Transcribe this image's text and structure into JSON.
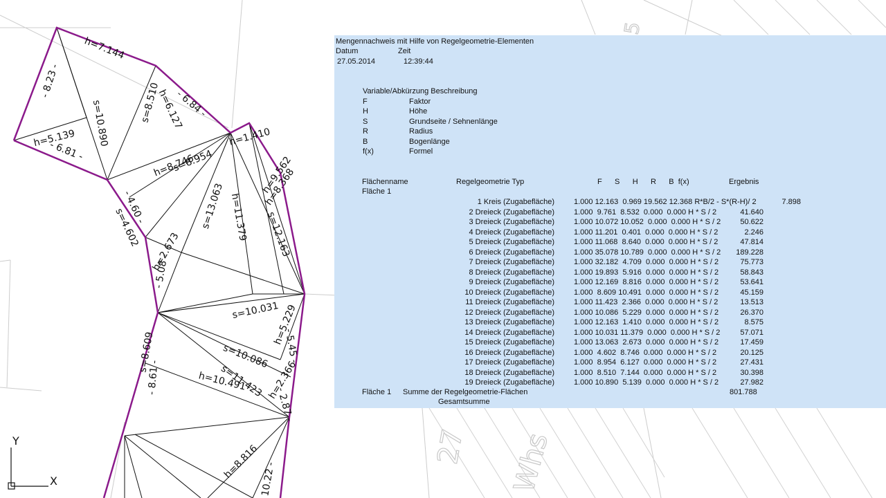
{
  "drawing": {
    "dimension_labels": [
      "h=7.144",
      "s=10.890",
      "s=8.510",
      "h=6.127",
      "- 6.84 -",
      "- 8.23 -",
      "h=5.139",
      "- 6.81 -",
      "h=8.746",
      "s=8.954",
      "h=1.410",
      "s=13.063",
      "h=11.379",
      "h=9.562",
      "h=8.368",
      "s=12.163",
      "- 4.60 -",
      "s=4.602",
      "h=2.673",
      "- 5.08 -",
      "s=10.031",
      "h=5.229",
      "- 5.45 -",
      "s=8.609",
      "s=10.086",
      "h=10.491",
      "s=11.423",
      "h=2.366",
      "- 8.61 -",
      "- 2.87 -",
      "h=8.816",
      "- 10.22 -"
    ],
    "hatch_text": [
      "27",
      "Whs",
      "5"
    ],
    "ucs": {
      "y_label": "Y",
      "x_label": "X"
    }
  },
  "report": {
    "title": "Mengennachweis mit Hilfe von Regelgeometrie-Elementen",
    "datum_label": "Datum",
    "zeit_label": "Zeit",
    "datum": "27.05.2014",
    "zeit": "12:39:44",
    "variables_header": "Variable/Abkürzung Beschreibung",
    "variables": [
      {
        "abbr": "F",
        "desc": "Faktor"
      },
      {
        "abbr": "H",
        "desc": "Höhe"
      },
      {
        "abbr": "S",
        "desc": "Grundseite / Sehnenlänge"
      },
      {
        "abbr": "R",
        "desc": "Radius"
      },
      {
        "abbr": "B",
        "desc": "Bogenlänge"
      },
      {
        "abbr": "f(x)",
        "desc": "Formel"
      }
    ],
    "table_headers": {
      "flaechenname": "Flächenname",
      "typ": "Regelgeometrie Typ",
      "cols": "F      S      H      R      B  f(x)",
      "ergebnis": "Ergebnis"
    },
    "flaeche": "Fläche 1",
    "rows": [
      {
        "typ": "1 Kreis (Zugabefläche)",
        "vals": "1.000 12.163  0.969 19.562 12.368 R*B/2 - S*(R-H)/ 2",
        "res": "7.898"
      },
      {
        "typ": "2 Dreieck (Zugabefläche)",
        "vals": "1.000  9.761  8.532  0.000  0.000 H * S / 2",
        "res": "41.640"
      },
      {
        "typ": "3 Dreieck (Zugabefläche)",
        "vals": "1.000 10.072 10.052  0.000  0.000 H * S / 2",
        "res": "50.622"
      },
      {
        "typ": "4 Dreieck (Zugabefläche)",
        "vals": "1.000 11.201  0.401  0.000  0.000 H * S / 2",
        "res": "2.246"
      },
      {
        "typ": "5 Dreieck (Zugabefläche)",
        "vals": "1.000 11.068  8.640  0.000  0.000 H * S / 2",
        "res": "47.814"
      },
      {
        "typ": "6 Dreieck (Zugabefläche)",
        "vals": "1.000 35.078 10.789  0.000  0.000 H * S / 2",
        "res": "189.228"
      },
      {
        "typ": "7 Dreieck (Zugabefläche)",
        "vals": "1.000 32.182  4.709  0.000  0.000 H * S / 2",
        "res": "75.773"
      },
      {
        "typ": "8 Dreieck (Zugabefläche)",
        "vals": "1.000 19.893  5.916  0.000  0.000 H * S / 2",
        "res": "58.843"
      },
      {
        "typ": "9 Dreieck (Zugabefläche)",
        "vals": "1.000 12.169  8.816  0.000  0.000 H * S / 2",
        "res": "53.641"
      },
      {
        "typ": "10 Dreieck (Zugabefläche)",
        "vals": "1.000  8.609 10.491  0.000  0.000 H * S / 2",
        "res": "45.159"
      },
      {
        "typ": "11 Dreieck (Zugabefläche)",
        "vals": "1.000 11.423  2.366  0.000  0.000 H * S / 2",
        "res": "13.513"
      },
      {
        "typ": "12 Dreieck (Zugabefläche)",
        "vals": "1.000 10.086  5.229  0.000  0.000 H * S / 2",
        "res": "26.370"
      },
      {
        "typ": "13 Dreieck (Zugabefläche)",
        "vals": "1.000 12.163  1.410  0.000  0.000 H * S / 2",
        "res": "8.575"
      },
      {
        "typ": "14 Dreieck (Zugabefläche)",
        "vals": "1.000 10.031 11.379  0.000  0.000 H * S / 2",
        "res": "57.071"
      },
      {
        "typ": "15 Dreieck (Zugabefläche)",
        "vals": "1.000 13.063  2.673  0.000  0.000 H * S / 2",
        "res": "17.459"
      },
      {
        "typ": "16 Dreieck (Zugabefläche)",
        "vals": "1.000  4.602  8.746  0.000  0.000 H * S / 2",
        "res": "20.125"
      },
      {
        "typ": "17 Dreieck (Zugabefläche)",
        "vals": "1.000  8.954  6.127  0.000  0.000 H * S / 2",
        "res": "27.431"
      },
      {
        "typ": "18 Dreieck (Zugabefläche)",
        "vals": "1.000  8.510  7.144  0.000  0.000 H * S / 2",
        "res": "30.398"
      },
      {
        "typ": "19 Dreieck (Zugabefläche)",
        "vals": "1.000 10.890  5.139  0.000  0.000 H * S / 2",
        "res": "27.982"
      }
    ],
    "summary_flaeche": "Fläche 1",
    "summary_label": "Summe der Regelgeometrie-Flächen",
    "summary_value": "801.788",
    "gesamtsumme_label": "Gesamtsumme"
  },
  "colors": {
    "report_background": "#cfe3f7",
    "boundary": "#8b1a8b",
    "triangle_lines": "#111111",
    "background_lines": "#c8c8c8"
  }
}
